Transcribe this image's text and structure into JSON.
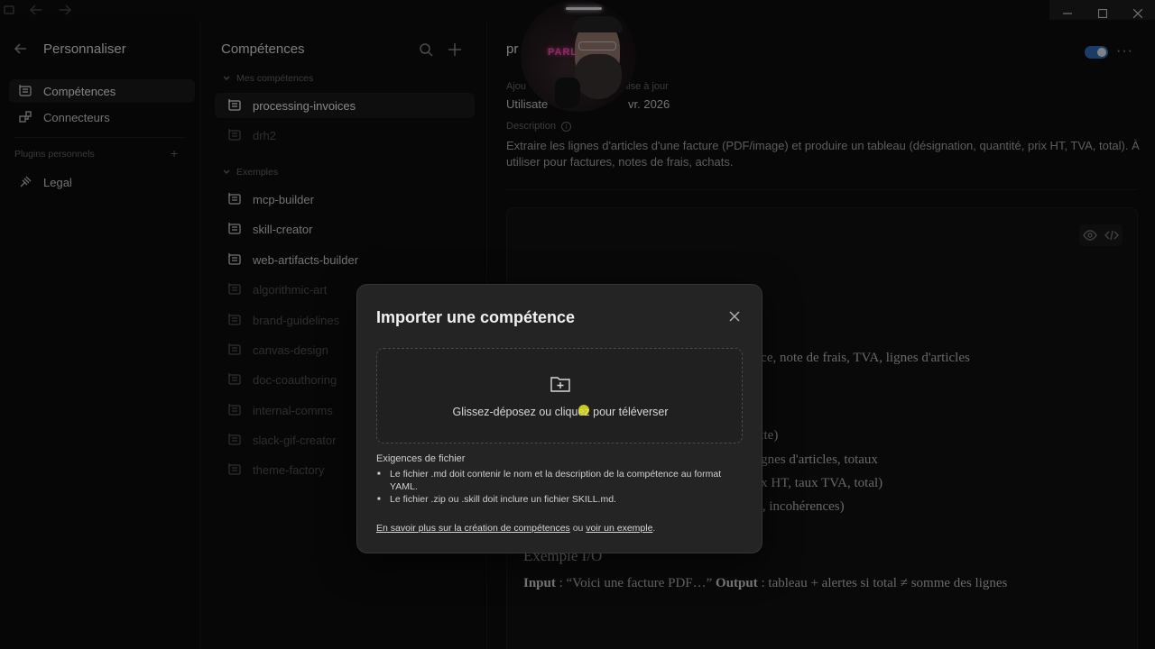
{
  "sidebar": {
    "title": "Personnaliser",
    "items": [
      {
        "label": "Compétences",
        "icon": "skills-icon",
        "active": true
      },
      {
        "label": "Connecteurs",
        "icon": "connectors-icon",
        "active": false
      }
    ],
    "section_label": "Plugins personnels",
    "plugins": [
      {
        "label": "Legal",
        "icon": "legal-icon"
      }
    ]
  },
  "skills_panel": {
    "title": "Compétences",
    "group_mine": "Mes compétences",
    "mine": [
      {
        "label": "processing-invoices",
        "selected": true
      },
      {
        "label": "drh2"
      }
    ],
    "group_examples": "Exemples",
    "examples": [
      {
        "label": "mcp-builder"
      },
      {
        "label": "skill-creator"
      },
      {
        "label": "web-artifacts-builder"
      },
      {
        "label": "algorithmic-art"
      },
      {
        "label": "brand-guidelines"
      },
      {
        "label": "canvas-design"
      },
      {
        "label": "doc-coauthoring"
      },
      {
        "label": "internal-comms"
      },
      {
        "label": "slack-gif-creator"
      },
      {
        "label": "theme-factory"
      }
    ]
  },
  "main": {
    "name_visible": "pr",
    "added_label": "Ajou",
    "updated_label": "mise à jour",
    "added_value": "Utilisate",
    "updated_value": "vr. 2026",
    "description_label": "Description",
    "description": "Extraire les lignes d'articles d'une facture (PDF/image) et produire un tableau (désignation, quantité, prix HT, TVA, total). À utiliser pour factures, notes de frais, achats.",
    "preview_lines": [
      "ice, note de frais, TVA, lignes d'articles",
      "xte)",
      "ignes d'articles, totaux",
      "ix HT, taux TVA, total)",
      "s, incohérences)"
    ],
    "preview_heading": "Exemple I/O",
    "io_input_label": "Input",
    "io_input_text": " : “Voici une facture PDF…” ",
    "io_output_label": "Output",
    "io_output_text": " : tableau + alertes si total ≠ somme des lignes"
  },
  "webcam": {
    "sign": "PARL"
  },
  "dialog": {
    "title": "Importer une compétence",
    "dropzone_text": "Glissez-déposez ou cliquez pour téléverser",
    "requirements_title": "Exigences de fichier",
    "requirements": [
      "Le fichier .md doit contenir le nom et la description de la compétence au format YAML.",
      "Le fichier .zip ou .skill doit inclure un fichier SKILL.md."
    ],
    "footer_link1": "En savoir plus sur la création de compétences",
    "footer_mid": " ou ",
    "footer_link2": "voir un exemple",
    "footer_end": "."
  },
  "colors": {
    "toggle_on": "#2f6fbf",
    "accent_cursor": "#e6e628",
    "dialog_bg": "#242424"
  }
}
